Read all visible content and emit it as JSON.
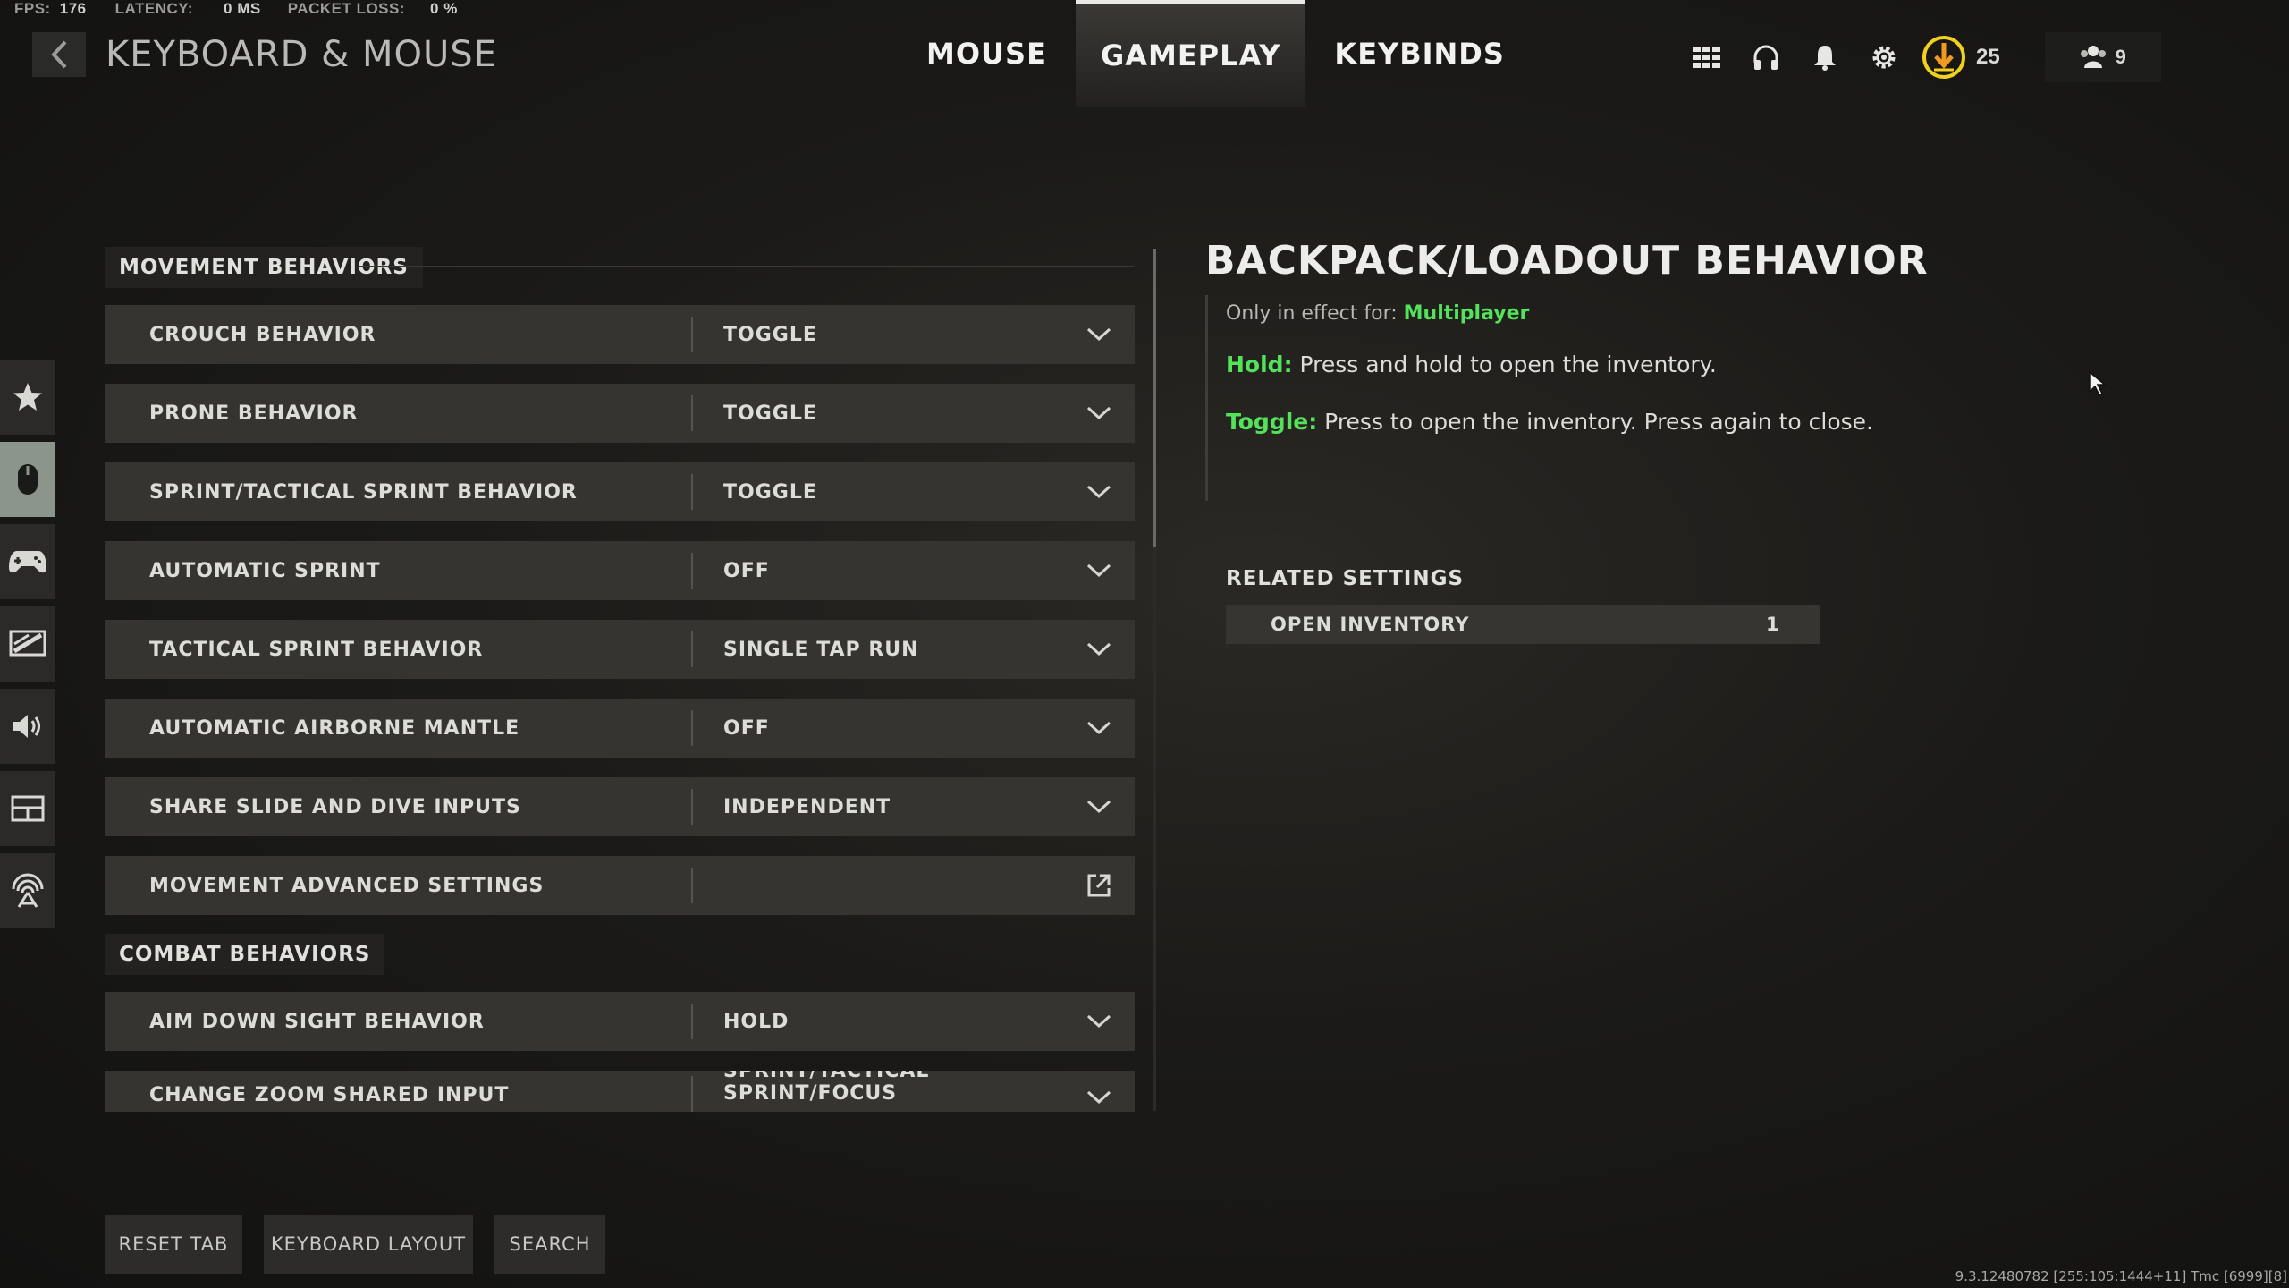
{
  "stats": {
    "fps_label": "FPS:",
    "fps": "176",
    "latency_label": "LATENCY:",
    "latency": "0 MS",
    "loss_label": "PACKET LOSS:",
    "loss": "0 %"
  },
  "header": {
    "title": "KEYBOARD & MOUSE"
  },
  "tabs": [
    {
      "label": "MOUSE"
    },
    {
      "label": "GAMEPLAY",
      "active": true
    },
    {
      "label": "KEYBINDS"
    }
  ],
  "topbar": {
    "xp_value": "25",
    "party_count": "9",
    "accent": "#f0d21e"
  },
  "sidenav": [
    "star-icon",
    "mouse-icon",
    "controller-icon",
    "display-icon",
    "speaker-icon",
    "interface-icon",
    "network-icon"
  ],
  "sections": [
    {
      "title": "MOVEMENT BEHAVIORS",
      "rows": [
        {
          "label": "CROUCH BEHAVIOR",
          "value": "TOGGLE"
        },
        {
          "label": "PRONE BEHAVIOR",
          "value": "TOGGLE"
        },
        {
          "label": "SPRINT/TACTICAL SPRINT BEHAVIOR",
          "value": "TOGGLE"
        },
        {
          "label": "AUTOMATIC SPRINT",
          "value": "OFF"
        },
        {
          "label": "TACTICAL SPRINT BEHAVIOR",
          "value": "SINGLE TAP RUN"
        },
        {
          "label": "AUTOMATIC AIRBORNE MANTLE",
          "value": "OFF"
        },
        {
          "label": "SHARE SLIDE AND DIVE INPUTS",
          "value": "INDEPENDENT"
        },
        {
          "label": "MOVEMENT ADVANCED SETTINGS",
          "value": ""
        }
      ]
    },
    {
      "title": "COMBAT BEHAVIORS",
      "rows": [
        {
          "label": "AIM DOWN SIGHT BEHAVIOR",
          "value": "HOLD"
        },
        {
          "label": "CHANGE ZOOM SHARED INPUT",
          "value": "SPRINT/TACTICAL SPRINT/FOCUS"
        }
      ]
    }
  ],
  "detail": {
    "title": "BACKPACK/LOADOUT BEHAVIOR",
    "effect_prefix": "Only in effect for: ",
    "effect_mode": "Multiplayer",
    "hold_key": "Hold:",
    "hold_text": " Press and hold to open the inventory.",
    "toggle_key": "Toggle:",
    "toggle_text": " Press to open the inventory. Press again to close.",
    "related_title": "RELATED SETTINGS",
    "related_label": "OPEN INVENTORY",
    "related_value": "1"
  },
  "bottom": {
    "reset": "RESET TAB",
    "layout": "KEYBOARD LAYOUT",
    "search": "SEARCH"
  },
  "version": "9.3.12480782 [255:105:1444+11] Tmc [6999][8]"
}
